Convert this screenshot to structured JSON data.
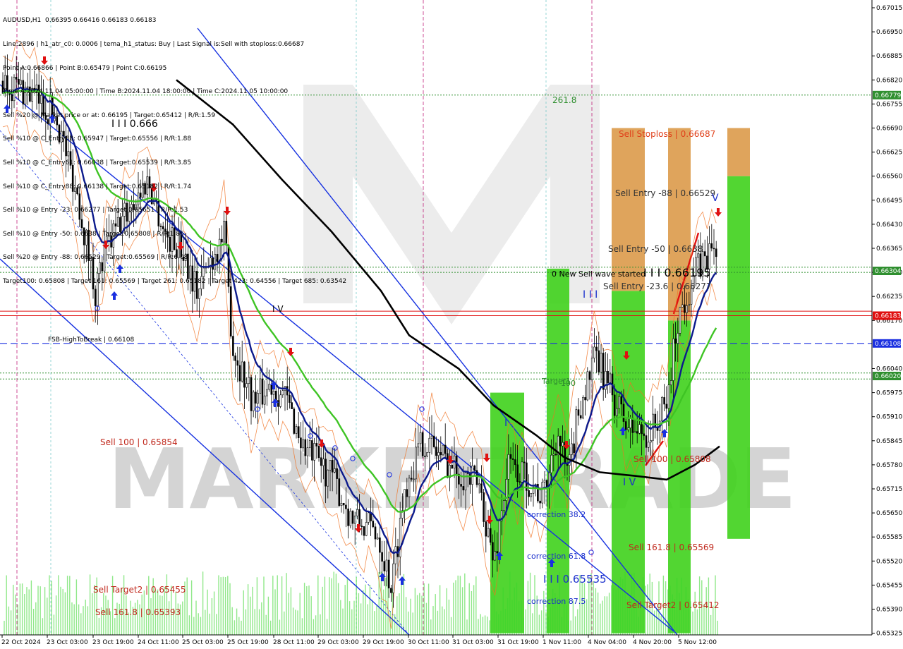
{
  "symbol_header": "AUDUSD,H1  0.66395 0.66416 0.66183 0.66183",
  "info_lines": [
    "Line:2896 | h1_atr_c0: 0.0006 | tema_h1_status: Buy | Last Signal is:Sell with stoploss:0.66687",
    "Point A:0.66866 | Point B:0.65479 | Point C:0.66195",
    "Time A:2024.11.04 05:00:00 | Time B:2024.11.04 18:00:00 | Time C:2024.11.05 10:00:00",
    "Sell %20 @ Market price or at: 0.66195 | Target:0.65412 | R/R:1.59",
    "Sell %10 @ C_Entry38: 0.65947 | Target:0.65556 | R/R:1.88",
    "Sell %10 @ C_Entry61: 0.66038 | Target:0.65539 | R/R:3.85",
    "Sell %10 @ C_Entry88: 0.66138 | Target:0.65182 | R/R:1.74",
    "Sell %10 @ Entry -23: 0.66277 | Target:0.65651 | R/R:1.53",
    "Sell %10 @ Entry -50: 0.6638 | Target:0.65808 | R/R:1.86",
    "Sell %20 @ Entry -88: 0.66529 | Target:0.65569 | R/R:6.08",
    "Target100: 0.65808 | Target 161: 0.65569 | Target 261: 0.65182 | Target 423: 0.64556 | Target 685: 0.63542"
  ],
  "colors": {
    "bull_candle": "#000000",
    "bear_candle": "#000000",
    "ma_black": "#000000",
    "ma_navy": "#0c1a8c",
    "ma_green": "#3ec424",
    "channel_blue": "#1530e0",
    "red_line": "#e01010",
    "dashed_blue": "#1a2fe0",
    "dotted_green": "#2f8f2f",
    "zone_green": "#3fd11c",
    "zone_orange": "#dc9a4a",
    "label_red": "#c0281c",
    "label_blue": "#1a2fcc",
    "volume": "#37d62b"
  },
  "chart_data": {
    "type": "candlestick",
    "symbol": "AUDUSD",
    "timeframe": "H1",
    "ohlc_header": {
      "open": 0.66395,
      "high": 0.66416,
      "low": 0.66183,
      "close": 0.66183
    },
    "y_range": [
      0.65325,
      0.66725
    ],
    "y_ticks": [
      "0.67015",
      "0.66950",
      "0.66885",
      "0.66820",
      "0.66755",
      "0.66690",
      "0.66625",
      "0.66560",
      "0.66495",
      "0.66430",
      "0.66365",
      "0.66300",
      "0.66235",
      "0.66170",
      "0.66040",
      "0.65975",
      "0.65910",
      "0.65845",
      "0.65780",
      "0.65715",
      "0.65650",
      "0.65585",
      "0.65520",
      "0.65455",
      "0.65390",
      "0.65325"
    ],
    "x_ticks": [
      "22 Oct 2024",
      "23 Oct 03:00",
      "23 Oct 19:00",
      "24 Oct 11:00",
      "25 Oct 03:00",
      "25 Oct 19:00",
      "28 Oct 11:00",
      "29 Oct 03:00",
      "29 Oct 19:00",
      "30 Oct 11:00",
      "31 Oct 03:00",
      "31 Oct 19:00",
      "1 Nov 11:00",
      "4 Nov 04:00",
      "4 Nov 20:00",
      "5 Nov 12:00"
    ],
    "price_tags": [
      {
        "value": 0.66779,
        "label": "0.66779",
        "color": "#2f8f2f"
      },
      {
        "value": 0.66304,
        "label": "0.66304",
        "color": "#2f8f2f"
      },
      {
        "value": 0.66183,
        "label": "0.66183",
        "color": "#e01010"
      },
      {
        "value": 0.66108,
        "label": "0.66108",
        "color": "#1a2fe0"
      },
      {
        "value": 0.6602,
        "label": "0.66020",
        "color": "#2f8f2f"
      }
    ],
    "horizontal_lines": [
      {
        "value": 0.66779,
        "style": "dotted",
        "color": "#2f8f2f"
      },
      {
        "value": 0.66314,
        "style": "dotted",
        "color": "#2f8f2f"
      },
      {
        "value": 0.663,
        "style": "dotted",
        "color": "#2f8f2f"
      },
      {
        "value": 0.66195,
        "style": "solid",
        "color": "#e01010"
      },
      {
        "value": 0.66183,
        "style": "solid",
        "color": "#e01010"
      },
      {
        "value": 0.66108,
        "style": "dashed",
        "color": "#1a2fe0"
      },
      {
        "value": 0.66028,
        "style": "dotted",
        "color": "#2f8f2f"
      },
      {
        "value": 0.66012,
        "style": "dotted",
        "color": "#2f8f2f"
      }
    ],
    "annotations": [
      {
        "text": "261.8",
        "color": "#2f8f2f"
      },
      {
        "text": "I I I 0.666",
        "color": "#000000"
      },
      {
        "text": "Sell Stoploss | 0.66687",
        "color": "#e0401a"
      },
      {
        "text": "Sell Entry -88 | 0.66529",
        "color": "#333333"
      },
      {
        "text": "Sell Entry -50 | 0.6638",
        "color": "#333333"
      },
      {
        "text": "0 New Sell wave started",
        "color": "#000000"
      },
      {
        "text": "I I I 0.66195",
        "color": "#000000"
      },
      {
        "text": "Sell Entry -23.6 | 0.66277",
        "color": "#333333"
      },
      {
        "text": "I I I",
        "color": "#1a2fcc"
      },
      {
        "text": "I V",
        "color": "#000000"
      },
      {
        "text": "FSB-HighToBreak | 0.66108",
        "color": "#000000"
      },
      {
        "text": "Target1",
        "color": "#2f8f2f"
      },
      {
        "text": "100",
        "color": "#2f8f2f"
      },
      {
        "text": "Sell 100 | 0.65854",
        "color": "#c0281c"
      },
      {
        "text": "Sell 100 | 0.65808",
        "color": "#c0281c"
      },
      {
        "text": "I",
        "color": "#1a2fcc"
      },
      {
        "text": "I V",
        "color": "#1a2fcc"
      },
      {
        "text": "correction 38.2",
        "color": "#1a2fcc"
      },
      {
        "text": "Sell 161.8 | 0.65569",
        "color": "#c0281c"
      },
      {
        "text": "correction 61.8",
        "color": "#1a2fcc"
      },
      {
        "text": "I I I 0.65535",
        "color": "#1a2fcc"
      },
      {
        "text": "Sell Target2 | 0.65455",
        "color": "#c0281c"
      },
      {
        "text": "correction 87.5",
        "color": "#1a2fcc"
      },
      {
        "text": "Sell 161.8 | 0.65393",
        "color": "#c0281c"
      },
      {
        "text": "Sell Target2 | 0.65412",
        "color": "#c0281c"
      },
      {
        "text": "V",
        "color": "#1a2fcc"
      }
    ],
    "zones": [
      {
        "kind": "green",
        "from": 0.65325,
        "to": 0.65975
      },
      {
        "kind": "green",
        "from": 0.65325,
        "to": 0.6631
      },
      {
        "kind": "green",
        "from": 0.65325,
        "to": 0.6625
      },
      {
        "kind": "orange",
        "from": 0.6625,
        "to": 0.6669
      },
      {
        "kind": "green",
        "from": 0.65325,
        "to": 0.6617
      },
      {
        "kind": "orange",
        "from": 0.6617,
        "to": 0.6669
      },
      {
        "kind": "green",
        "from": 0.6558,
        "to": 0.6656
      },
      {
        "kind": "orange",
        "from": 0.6656,
        "to": 0.6669
      }
    ],
    "watermark": "MARKETTRADE"
  }
}
